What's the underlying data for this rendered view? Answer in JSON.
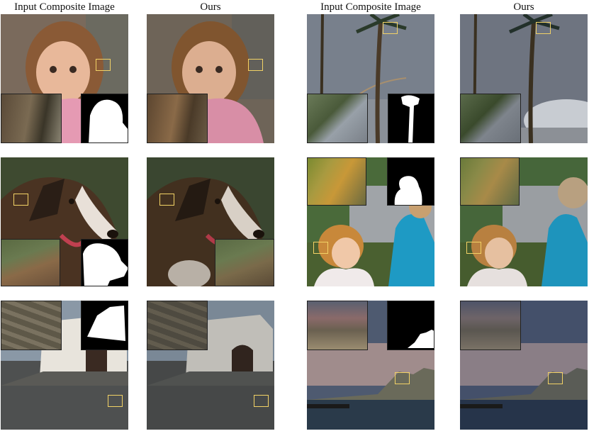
{
  "headers": {
    "left_input": "Input Composite Image",
    "left_ours": "Ours",
    "right_input": "Input Composite Image",
    "right_ours": "Ours"
  },
  "rows": [
    {
      "left": "toddler-girl-pink-jacket",
      "right": "palm-trees-rainbow-sky"
    },
    {
      "left": "brindle-dog-portrait",
      "right": "two-children-blue-jacket"
    },
    {
      "left": "white-chapel-cobblestone",
      "right": "coastal-cliffs-harbor"
    }
  ],
  "colors": {
    "highlight_box": "#f2d266",
    "mask_fg": "#ffffff",
    "mask_bg": "#000000"
  }
}
